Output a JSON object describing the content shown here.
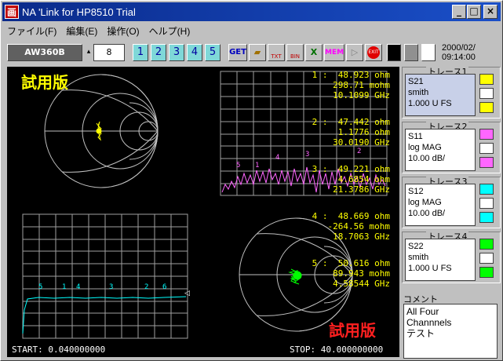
{
  "window": {
    "title": "NA 'Link for HP8510 Trial",
    "app_icon_char": "画",
    "minimize": "_",
    "maximize": "□",
    "close": "×"
  },
  "menu": [
    "ファイル(F)",
    "編集(E)",
    "操作(O)",
    "ヘルプ(H)"
  ],
  "toolbar": {
    "model": "AW360B",
    "count": "8",
    "channels": [
      "1",
      "2",
      "3",
      "4",
      "5"
    ],
    "get": "GET",
    "txt": "TXT",
    "bin": "BIN",
    "mem": "MEM",
    "exit": "EXIT",
    "date": "2000/02/",
    "time": "09:14:00"
  },
  "screen": {
    "watermark_top": "試用版",
    "watermark_bottom": "試用版",
    "start": "START: 0.040000000",
    "stop": "STOP: 40.000000000",
    "markers": [
      {
        "l1": "1 :  48.923 ohm",
        "l2": "298.71 mohm",
        "l3": "10.1099 GHz"
      },
      {
        "l1": "2 :  47.442 ohm",
        "l2": "1.1776 ohm",
        "l3": "30.0190 GHz"
      },
      {
        "l1": "3 :  49.221 ohm",
        "l2": "4.6854 ohm",
        "l3": "21.3786 GHz"
      },
      {
        "l1": "4 :  48.669 ohm",
        "l2": "-264.56 mohm",
        "l3": "18.7063 GHz"
      },
      {
        "l1": "5 :  50.616 ohm",
        "l2": "89.943 mohm",
        "l3": "4.58544 GHz"
      }
    ]
  },
  "traces": [
    {
      "title": "トレース1",
      "param": "S21",
      "format": "smith",
      "scale": "1.000 U FS",
      "color": "#ffff00"
    },
    {
      "title": "トレース2",
      "param": "S11",
      "format": "log MAG",
      "scale": "10.00 dB/",
      "color": "#ff66ff"
    },
    {
      "title": "トレース3",
      "param": "S12",
      "format": "log MAG",
      "scale": "10.00 dB/",
      "color": "#00ffff"
    },
    {
      "title": "トレース4",
      "param": "S22",
      "format": "smith",
      "scale": "1.000 U FS",
      "color": "#00ff00"
    }
  ],
  "comment": {
    "title": "コメント",
    "lines": [
      "All Four",
      "Channnels",
      "テスト"
    ]
  },
  "colors": {
    "title_blue": "#0a2a8a",
    "screen_bg": "#000000",
    "grid": "#c0c0c0"
  }
}
